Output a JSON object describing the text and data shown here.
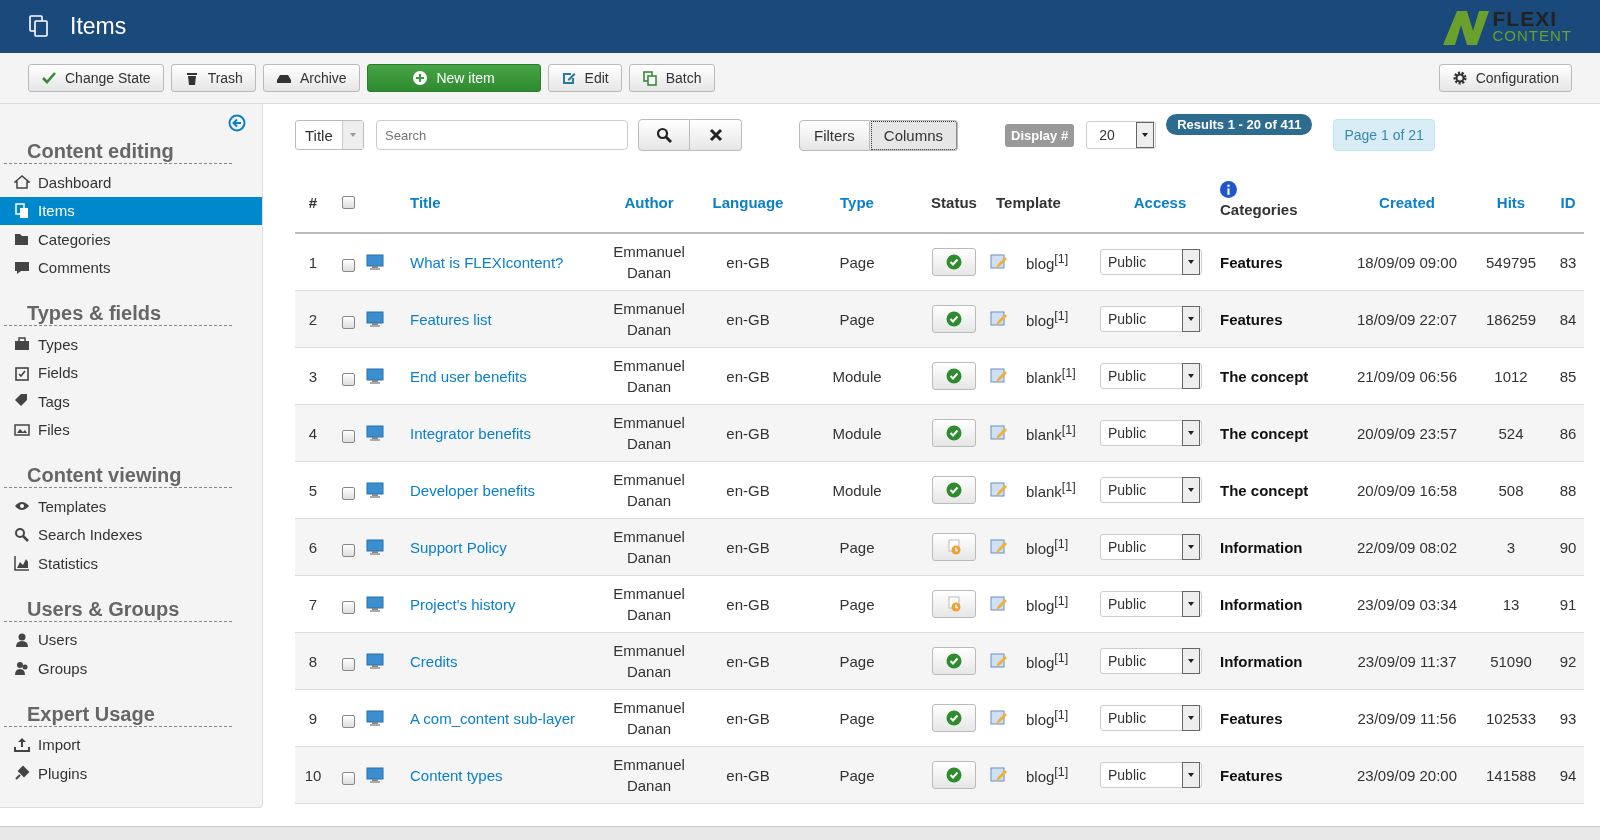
{
  "header": {
    "title": "Items",
    "logo": {
      "top": "FLEXI",
      "bottom": "CONTENT"
    }
  },
  "toolbar": {
    "buttons": [
      {
        "label": "Change State",
        "kind": "default"
      },
      {
        "label": "Trash",
        "kind": "default"
      },
      {
        "label": "Archive",
        "kind": "default"
      },
      {
        "label": "New item",
        "kind": "primary"
      },
      {
        "label": "Edit",
        "kind": "default"
      },
      {
        "label": "Batch",
        "kind": "default"
      }
    ],
    "configuration": "Configuration"
  },
  "sidebar": {
    "groups": [
      {
        "title": "Content editing",
        "items": [
          {
            "label": "Dashboard",
            "selected": false
          },
          {
            "label": "Items",
            "selected": true
          },
          {
            "label": "Categories",
            "selected": false
          },
          {
            "label": "Comments",
            "selected": false
          }
        ]
      },
      {
        "title": "Types & fields",
        "items": [
          {
            "label": "Types",
            "selected": false
          },
          {
            "label": "Fields",
            "selected": false
          },
          {
            "label": "Tags",
            "selected": false
          },
          {
            "label": "Files",
            "selected": false
          }
        ]
      },
      {
        "title": "Content viewing",
        "items": [
          {
            "label": "Templates",
            "selected": false
          },
          {
            "label": "Search Indexes",
            "selected": false
          },
          {
            "label": "Statistics",
            "selected": false
          }
        ]
      },
      {
        "title": "Users & Groups",
        "items": [
          {
            "label": "Users",
            "selected": false
          },
          {
            "label": "Groups",
            "selected": false
          }
        ]
      },
      {
        "title": "Expert Usage",
        "items": [
          {
            "label": "Import",
            "selected": false
          },
          {
            "label": "Plugins",
            "selected": false
          }
        ]
      }
    ]
  },
  "filter_bar": {
    "search_in": "Title",
    "search": {
      "placeholder": "Search"
    },
    "toggles": [
      {
        "label": "Filters",
        "selected": false
      },
      {
        "label": "Columns",
        "selected": true
      }
    ],
    "display_label": "Display #",
    "display_value": "20",
    "results": "Results 1 - 20 of 411",
    "page": "Page 1 of 21"
  },
  "table": {
    "select_all": {
      "checked": false
    },
    "columns": [
      "#",
      "Title",
      "Author",
      "Language",
      "Type",
      "Status",
      "Template",
      "Access",
      "Categories",
      "Created",
      "Hits",
      "ID"
    ],
    "rows": [
      {
        "num": "1",
        "title": "What is FLEXIcontent?",
        "author": "Emmanuel Danan",
        "language": "en-GB",
        "type": "Page",
        "published": true,
        "template": "blog$^{[1]}$",
        "access": "Public",
        "category": "Features",
        "created": "18/09/09 09:00",
        "hits": "549795",
        "id": "83",
        "checked": false
      },
      {
        "num": "2",
        "title": "Features list",
        "author": "Emmanuel Danan",
        "language": "en-GB",
        "type": "Page",
        "published": true,
        "template": "blog$^{[1]}$",
        "access": "Public",
        "category": "Features",
        "created": "18/09/09 22:07",
        "hits": "186259",
        "id": "84",
        "checked": false
      },
      {
        "num": "3",
        "title": "End user benefits",
        "author": "Emmanuel Danan",
        "language": "en-GB",
        "type": "Module",
        "published": true,
        "template": "blank$^{[1]}$",
        "access": "Public",
        "category": "The concept",
        "created": "21/09/09 06:56",
        "hits": "1012",
        "id": "85",
        "checked": false
      },
      {
        "num": "4",
        "title": "Integrator benefits",
        "author": "Emmanuel Danan",
        "language": "en-GB",
        "type": "Module",
        "published": true,
        "template": "blank$^{[1]}$",
        "access": "Public",
        "category": "The concept",
        "created": "20/09/09 23:57",
        "hits": "524",
        "id": "86",
        "checked": false
      },
      {
        "num": "5",
        "title": "Developer benefits",
        "author": "Emmanuel Danan",
        "language": "en-GB",
        "type": "Module",
        "published": true,
        "template": "blank$^{[1]}$",
        "access": "Public",
        "category": "The concept",
        "created": "20/09/09 16:58",
        "hits": "508",
        "id": "88",
        "checked": false
      },
      {
        "num": "6",
        "title": "Support Policy",
        "author": "Emmanuel Danan",
        "language": "en-GB",
        "type": "Page",
        "published": false,
        "template": "blog$^{[1]}$",
        "access": "Public",
        "category": "Information",
        "created": "22/09/09 08:02",
        "hits": "3",
        "id": "90",
        "checked": false
      },
      {
        "num": "7",
        "title": "Project's history",
        "author": "Emmanuel Danan",
        "language": "en-GB",
        "type": "Page",
        "published": false,
        "template": "blog$^{[1]}$",
        "access": "Public",
        "category": "Information",
        "created": "23/09/09 03:34",
        "hits": "13",
        "id": "91",
        "checked": false
      },
      {
        "num": "8",
        "title": "Credits",
        "author": "Emmanuel Danan",
        "language": "en-GB",
        "type": "Page",
        "published": true,
        "template": "blog$^{[1]}$",
        "access": "Public",
        "category": "Information",
        "created": "23/09/09 11:37",
        "hits": "51090",
        "id": "92",
        "checked": false
      },
      {
        "num": "9",
        "title": "A com_content sub-layer",
        "author": "Emmanuel Danan",
        "language": "en-GB",
        "type": "Page",
        "published": true,
        "template": "blog$^{[1]}$",
        "access": "Public",
        "category": "Features",
        "created": "23/09/09 11:56",
        "hits": "102533",
        "id": "93",
        "checked": false
      },
      {
        "num": "10",
        "title": "Content types",
        "author": "Emmanuel Danan",
        "language": "en-GB",
        "type": "Page",
        "published": true,
        "template": "blog$^{[1]}$",
        "access": "Public",
        "category": "Features",
        "created": "23/09/09 20:00",
        "hits": "141588",
        "id": "94",
        "checked": false
      }
    ]
  }
}
